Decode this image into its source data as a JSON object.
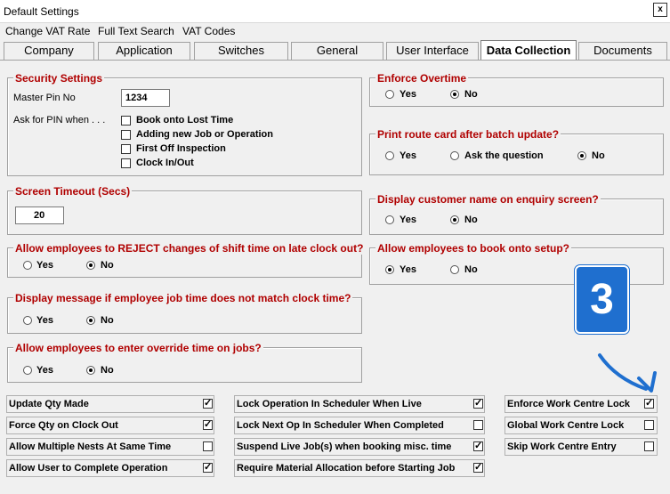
{
  "window": {
    "title": "Default Settings",
    "close": "x"
  },
  "menu": [
    "Change VAT Rate",
    "Full Text Search",
    "VAT Codes"
  ],
  "tabs": [
    "Company",
    "Application",
    "Switches",
    "General",
    "User Interface",
    "Data Collection",
    "Documents"
  ],
  "active_tab": "Data Collection",
  "security": {
    "title": "Security Settings",
    "master_pin_label": "Master Pin No",
    "master_pin_value": "1234",
    "ask_pin_label": "Ask for PIN when . . .",
    "options": [
      {
        "label": "Book onto Lost Time",
        "checked": false
      },
      {
        "label": "Adding new Job or Operation",
        "checked": false
      },
      {
        "label": "First Off Inspection",
        "checked": false
      },
      {
        "label": "Clock In/Out",
        "checked": false
      }
    ]
  },
  "timeout": {
    "title": "Screen Timeout (Secs)",
    "value": "20"
  },
  "questions_left": [
    {
      "title": "Allow employees to REJECT changes of shift time on late clock out?",
      "yes": "Yes",
      "no": "No",
      "selected": "No"
    },
    {
      "title": "Display message if employee job time does not match clock time?",
      "yes": "Yes",
      "no": "No",
      "selected": "No"
    },
    {
      "title": "Allow employees to enter override time on jobs?",
      "yes": "Yes",
      "no": "No",
      "selected": "No"
    }
  ],
  "enforce_overtime": {
    "title": "Enforce Overtime",
    "yes": "Yes",
    "no": "No",
    "selected": "No"
  },
  "route_card": {
    "title": "Print route card after batch update?",
    "yes": "Yes",
    "ask": "Ask the question",
    "no": "No",
    "selected": "No"
  },
  "customer_name": {
    "title": "Display customer name on enquiry screen?",
    "yes": "Yes",
    "no": "No",
    "selected": "No"
  },
  "setup": {
    "title": "Allow employees to book onto setup?",
    "yes": "Yes",
    "no": "No",
    "selected": "Yes"
  },
  "flags_col1": [
    {
      "label": "Update Qty Made",
      "checked": true
    },
    {
      "label": "Force Qty on Clock Out",
      "checked": true
    },
    {
      "label": "Allow Multiple Nests At Same Time",
      "checked": false
    },
    {
      "label": "Allow User to Complete Operation",
      "checked": true
    }
  ],
  "flags_col2": [
    {
      "label": "Lock Operation In Scheduler When Live",
      "checked": true
    },
    {
      "label": "Lock Next Op In Scheduler When Completed",
      "checked": false
    },
    {
      "label": "Suspend Live Job(s) when booking misc. time",
      "checked": true
    },
    {
      "label": "Require Material Allocation before Starting Job",
      "checked": true
    }
  ],
  "flags_col3": [
    {
      "label": "Enforce Work Centre Lock",
      "checked": true
    },
    {
      "label": "Global Work Centre Lock",
      "checked": false
    },
    {
      "label": "Skip Work Centre Entry",
      "checked": false
    }
  ],
  "annotation": {
    "badge": "3",
    "color": "#1f6fcf"
  }
}
